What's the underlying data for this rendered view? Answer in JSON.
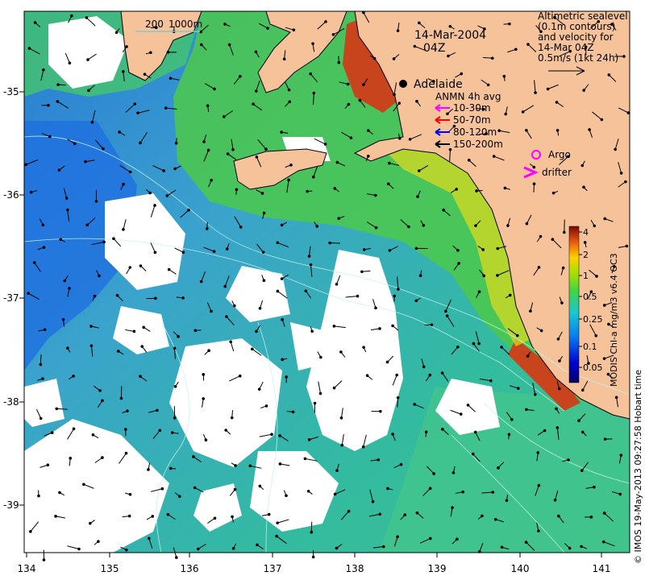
{
  "title": {
    "date": "14-Mar-2004",
    "time": "04Z"
  },
  "scale_bar": {
    "label_200": "200",
    "label_1000": "1000m"
  },
  "altimetry_note": {
    "lines": [
      "Altimetric sealevel",
      "(0.1m contours)",
      "and velocity for",
      "14-Mar 04Z",
      "0.5m/s (1kt 24h)"
    ]
  },
  "city": {
    "name": "Adelaide"
  },
  "anmn": {
    "title": "ANMN 4h avg",
    "entries": [
      {
        "label": "10-30m",
        "color": "#ff00ff"
      },
      {
        "label": "50-70m",
        "color": "#ff0000"
      },
      {
        "label": "80-120m",
        "color": "#0000ff"
      },
      {
        "label": "150-200m",
        "color": "#000000"
      }
    ]
  },
  "argo": {
    "label": "Argo",
    "color": "#ff00ff"
  },
  "drifter": {
    "label": "drifter",
    "color": "#ff00ff"
  },
  "colorbar": {
    "label": "MODIS Chl-a mg/m3 v6.4 OC3",
    "ticks": [
      "4",
      "2",
      "1",
      "0.5",
      "0.25",
      "0.1",
      "0.05"
    ]
  },
  "credit": "© IMOS 19-May-2013 09:27:58 Hobart time",
  "axes": {
    "x_ticks": [
      "134",
      "135",
      "136",
      "137",
      "138",
      "139",
      "140",
      "141"
    ],
    "y_ticks": [
      "-35",
      "-36",
      "-37",
      "-38",
      "-39"
    ]
  },
  "colors": {
    "land": "#f5c29a",
    "cloud": "#ffffff",
    "chl_low": "#2a7bd6",
    "chl_mid": "#2fb8a2",
    "chl_high": "#4fd13a",
    "chl_peak": "#c8441c"
  }
}
